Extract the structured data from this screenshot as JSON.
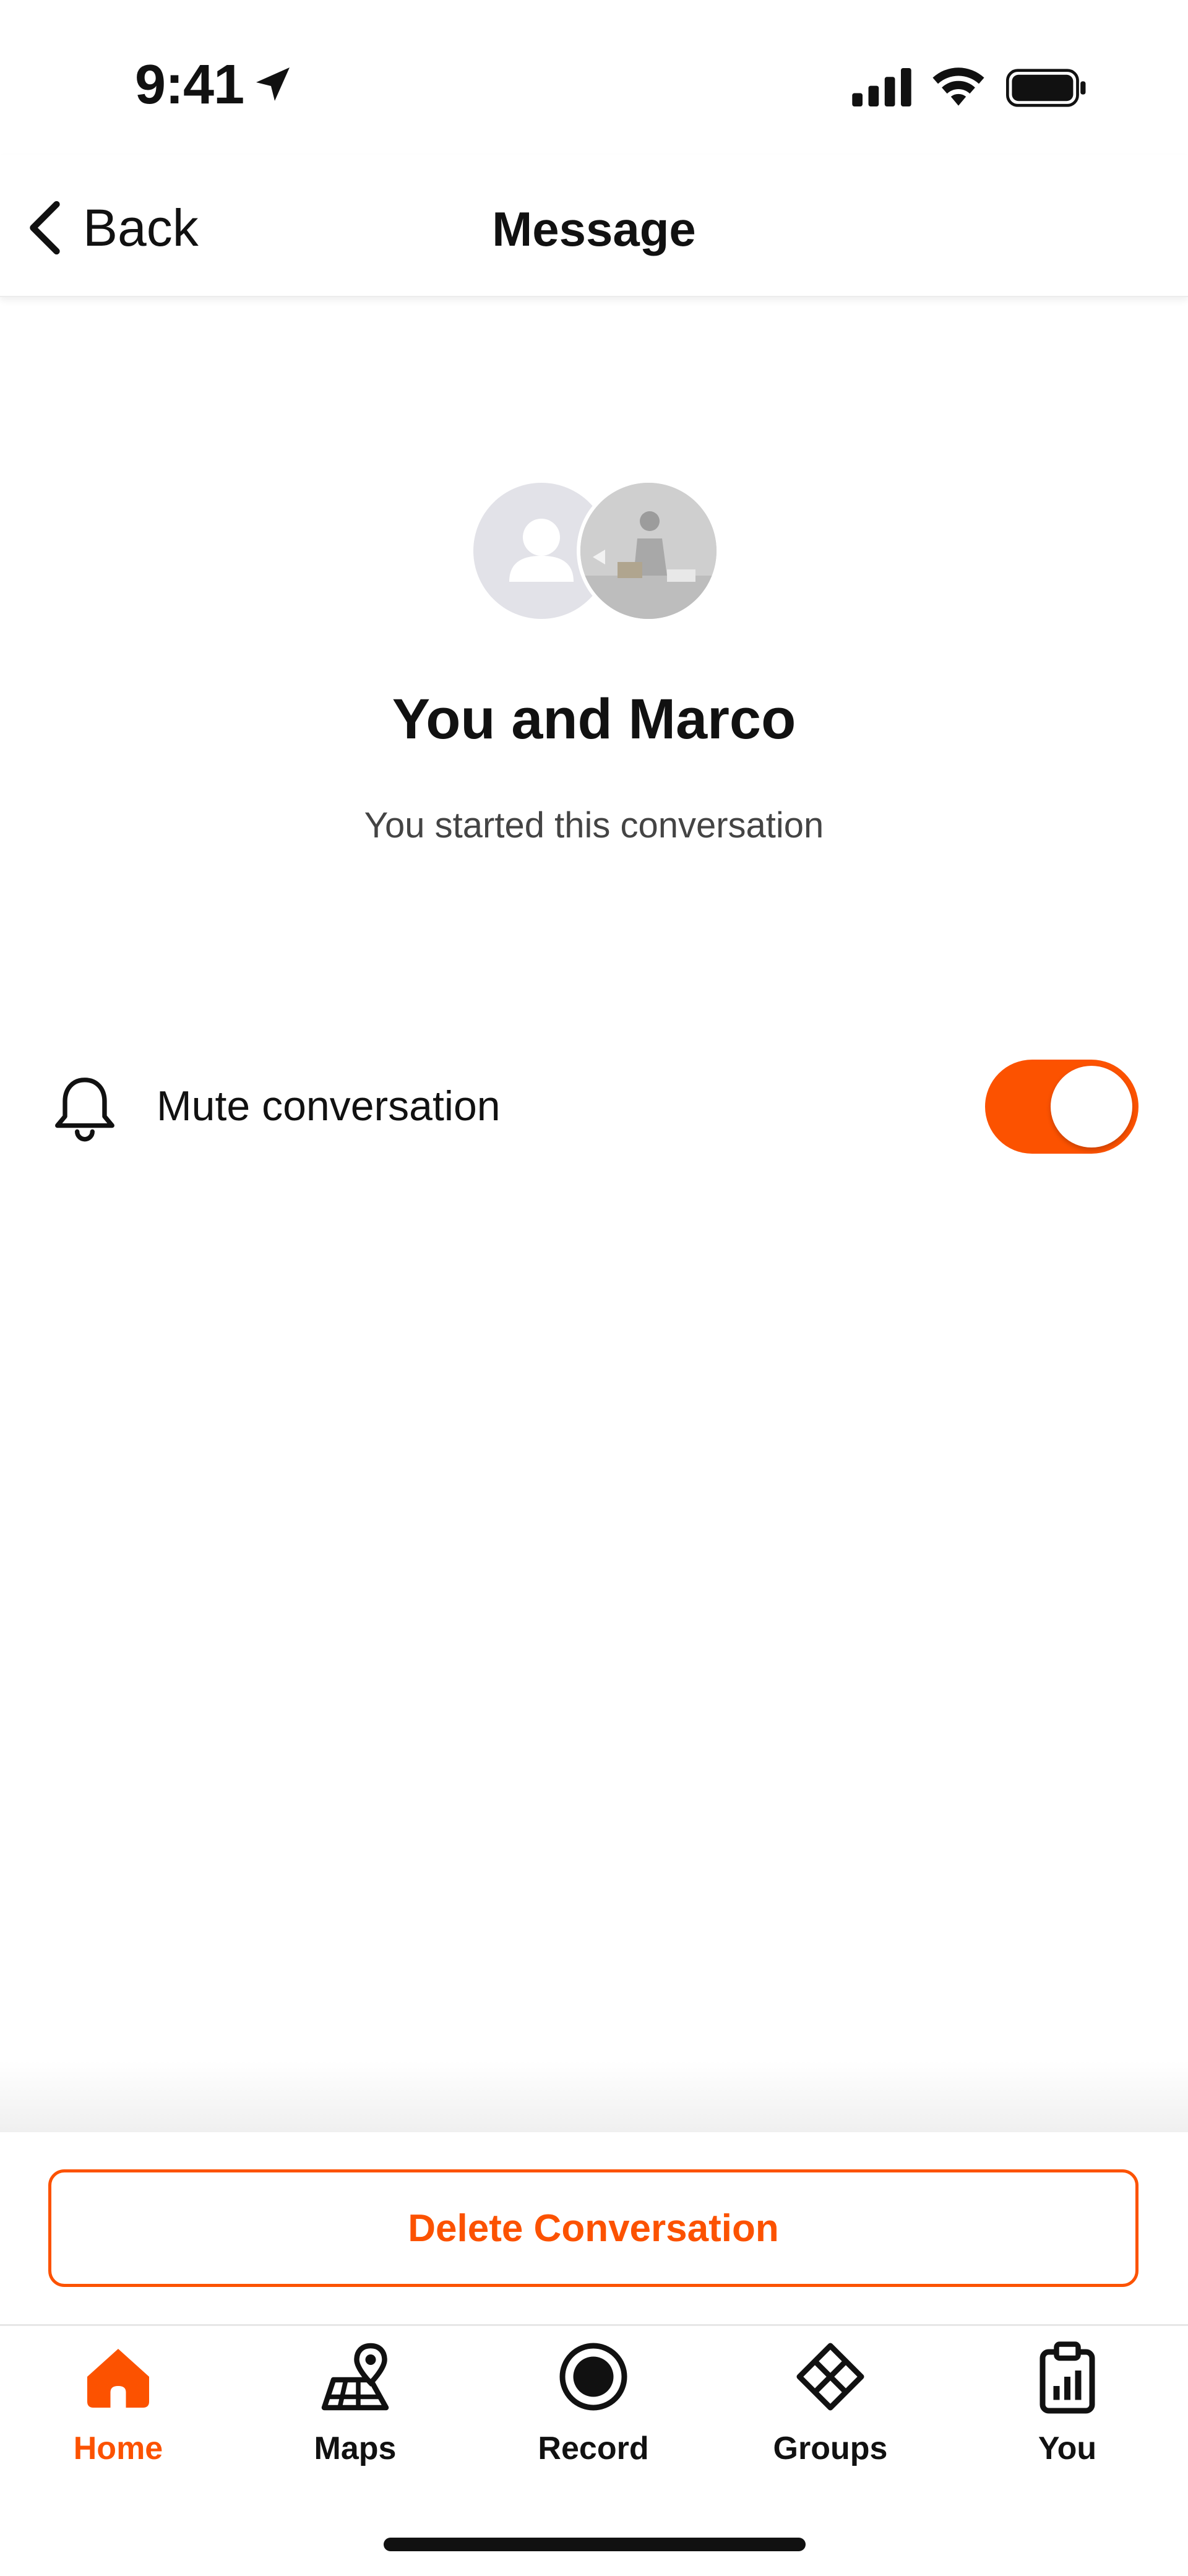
{
  "status_bar": {
    "time": "9:41"
  },
  "header": {
    "back_label": "Back",
    "title": "Message"
  },
  "conversation": {
    "title": "You and Marco",
    "subtitle": "You started this conversation"
  },
  "settings": {
    "mute_label": "Mute conversation",
    "mute_enabled": true
  },
  "actions": {
    "delete_label": "Delete Conversation"
  },
  "tabbar": {
    "items": [
      {
        "label": "Home",
        "icon": "home-icon",
        "active": true
      },
      {
        "label": "Maps",
        "icon": "maps-icon",
        "active": false
      },
      {
        "label": "Record",
        "icon": "record-icon",
        "active": false
      },
      {
        "label": "Groups",
        "icon": "groups-icon",
        "active": false
      },
      {
        "label": "You",
        "icon": "you-icon",
        "active": false
      }
    ]
  },
  "colors": {
    "accent": "#fc5200",
    "text": "#111111",
    "muted_text": "#444444"
  }
}
